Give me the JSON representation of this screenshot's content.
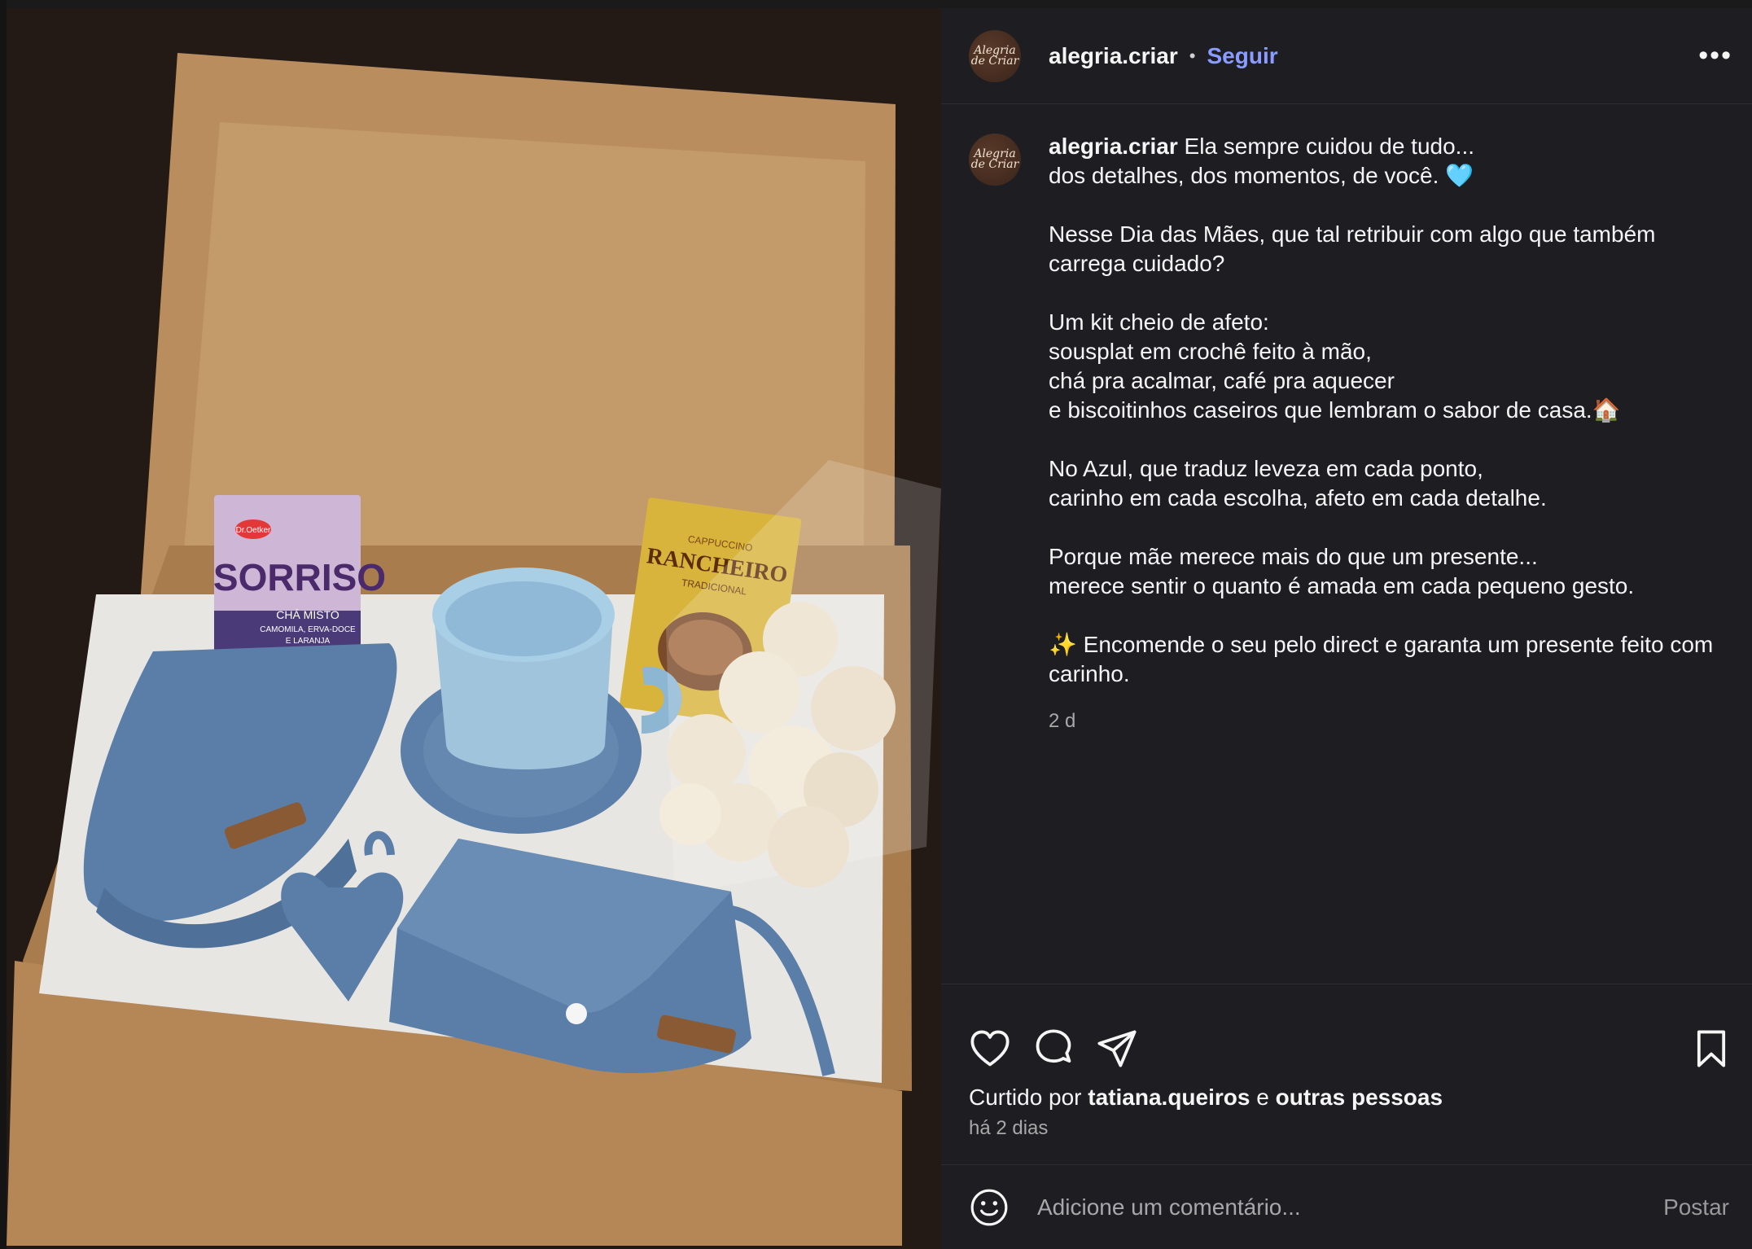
{
  "post": {
    "username": "alegria.criar",
    "follow_label": "Seguir",
    "separator": "•",
    "more_icon": "more-horizontal-icon",
    "avatar_text": "Alegria de Criar"
  },
  "caption": {
    "username": "alegria.criar",
    "text": " Ela sempre cuidou de tudo...\ndos detalhes, dos momentos, de você. 🩵\n\nNesse Dia das Mães, que tal retribuir com algo que também carrega cuidado?\n\nUm kit cheio de afeto:\nsousplat em crochê feito à mão,\nchá pra acalmar, café pra aquecer\ne biscoitinhos caseiros que lembram o sabor de casa.🏠\n\nNo Azul, que traduz leveza em cada ponto,\ncarinho em cada escolha, afeto em cada detalhe.\n\nPorque mãe merece mais do que um presente...\nmerece sentir o quanto é amada em cada pequeno gesto.\n\n✨ Encomende o seu pelo direct e garanta um presente feito com carinho.",
    "time": "2 d"
  },
  "actions": {
    "like_icon": "heart-icon",
    "comment_icon": "comment-icon",
    "share_icon": "share-icon",
    "save_icon": "bookmark-icon"
  },
  "likes": {
    "prefix": "Curtido por ",
    "user": "tatiana.queiros",
    "conj": " e ",
    "others": "outras pessoas"
  },
  "posted": "há 2 dias",
  "comment": {
    "placeholder": "Adicione um comentário...",
    "post_label": "Postar"
  },
  "photo_text": {
    "tea_brand": "Dr.Oetker",
    "tea_name": "SORRISO",
    "tea_sub1": "CHÁ MISTO",
    "tea_sub2": "CAMOMILA, ERVA-DOCE",
    "tea_sub3": "E LARANJA",
    "coffee_top": "CAPPUCCINO",
    "coffee_name": "RANCHEIRO",
    "coffee_sub": "TRADICIONAL"
  },
  "colors": {
    "panel_bg": "#1e1e22",
    "follow": "#8a9cff",
    "muted": "#a8a8a8",
    "crochet": "#5b7fa8"
  }
}
